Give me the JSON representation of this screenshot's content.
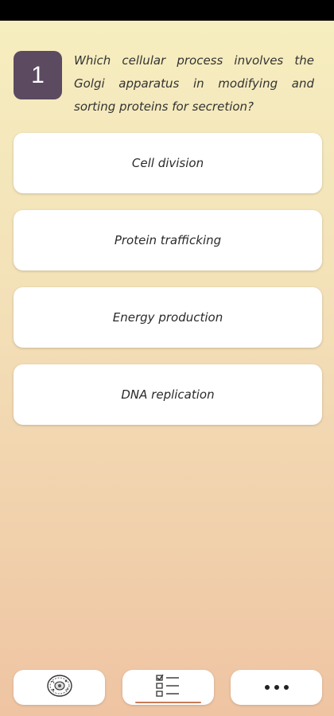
{
  "question": {
    "number": "1",
    "text": "Which cellular process involves the Golgi apparatus in modifying and sorting proteins for secretion?"
  },
  "options": [
    {
      "label": "Cell division"
    },
    {
      "label": "Protein trafficking"
    },
    {
      "label": "Energy production"
    },
    {
      "label": "DNA replication"
    }
  ],
  "bottom_nav": {
    "items": [
      {
        "icon": "cell-icon"
      },
      {
        "icon": "checklist-icon",
        "active": true
      },
      {
        "icon": "more-icon"
      }
    ]
  },
  "colors": {
    "badge": "#5c4a61",
    "bg_top": "#f6efc0",
    "bg_bottom": "#efc4a3",
    "active_underline": "#c87a56"
  }
}
